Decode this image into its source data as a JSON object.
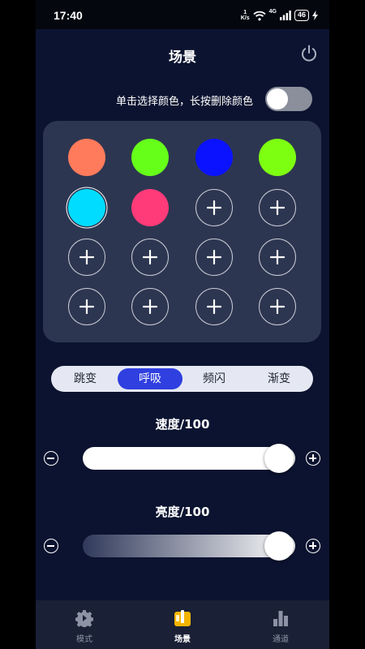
{
  "status_bar": {
    "time": "17:40",
    "net_speed_value": "1",
    "net_speed_unit": "K/s",
    "network_type": "4G",
    "battery": "46",
    "icons": [
      "network-speed-icon",
      "wifi-icon",
      "cellular-signal-icon",
      "battery-icon",
      "charging-icon"
    ]
  },
  "header": {
    "title": "场景",
    "power_icon": "power-icon"
  },
  "toggle_row": {
    "hint": "单击选择颜色，长按删除颜色",
    "enabled": false
  },
  "color_grid": {
    "swatches": [
      {
        "color": "#ff7b5c",
        "selected": false
      },
      {
        "color": "#66ff1a",
        "selected": false
      },
      {
        "color": "#0b12ff",
        "selected": false
      },
      {
        "color": "#7dff12",
        "selected": false
      },
      {
        "color": "#00dcff",
        "selected": true
      },
      {
        "color": "#ff3b79",
        "selected": false
      }
    ],
    "empty_slot_count": 10,
    "add_icon": "plus-icon"
  },
  "mode_tabs": {
    "items": [
      "跳变",
      "呼吸",
      "频闪",
      "渐变"
    ],
    "active_index": 1
  },
  "speed": {
    "label": "速度/100",
    "value_fraction": 1.0
  },
  "brightness": {
    "label": "亮度/100",
    "value_fraction": 1.0
  },
  "bottom_nav": {
    "items": [
      {
        "label": "模式",
        "icon": "gear-icon"
      },
      {
        "label": "场景",
        "icon": "scene-icon"
      },
      {
        "label": "通道",
        "icon": "bar-chart-icon"
      }
    ],
    "active_index": 1
  },
  "colors": {
    "background": "#0b1330",
    "panel": "#2d3651",
    "accent": "#2f3fe0",
    "active_icon": "#f4b400"
  }
}
